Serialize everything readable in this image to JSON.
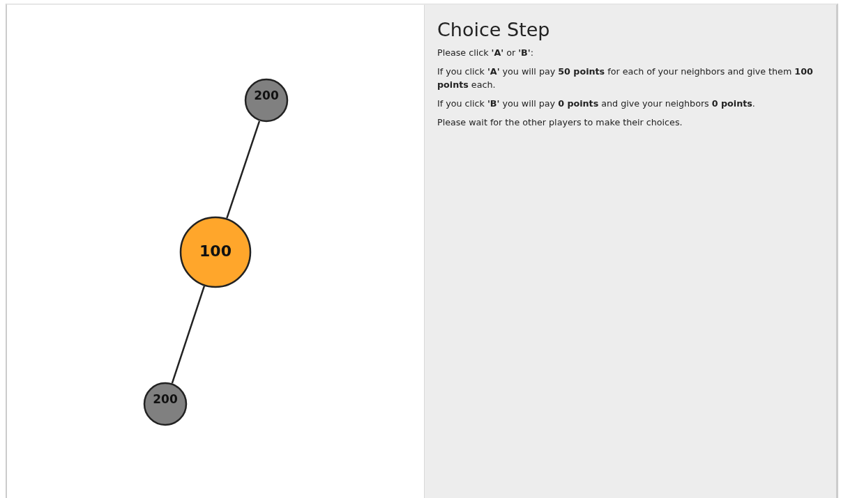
{
  "network": {
    "nodes": [
      {
        "label": "200",
        "kind": "neighbor",
        "color": "#808080"
      },
      {
        "label": "100",
        "kind": "self",
        "color": "#ffa62b"
      },
      {
        "label": "200",
        "kind": "neighbor",
        "color": "#808080"
      }
    ]
  },
  "panel": {
    "title": "Choice Step",
    "paragraphs": [
      "Please click **'A'** or **'B'**:",
      "If you click **'A'** you will pay **50 points** for each of your neighbors and give them **100 points** each.",
      "If you click **'B'** you will pay **0 points** and give your neighbors **0 points**.",
      "Please wait for the other players to make their choices."
    ]
  }
}
